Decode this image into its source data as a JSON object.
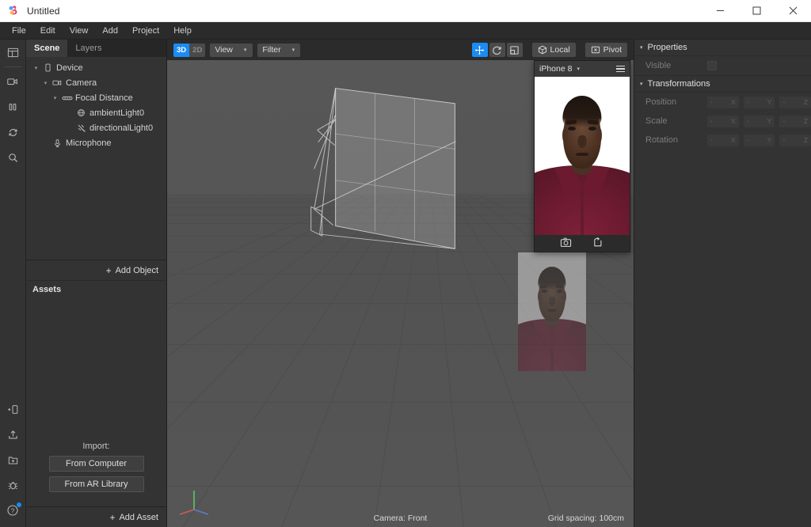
{
  "window": {
    "title": "Untitled",
    "logo_icon": "spark-ar-logo-icon",
    "minimize_label": "–",
    "maximize_label": "☐",
    "close_label": "✕"
  },
  "menubar": {
    "items": [
      {
        "label": "File"
      },
      {
        "label": "Edit"
      },
      {
        "label": "View"
      },
      {
        "label": "Add"
      },
      {
        "label": "Project"
      },
      {
        "label": "Help"
      }
    ]
  },
  "rail": {
    "top_icons": [
      {
        "name": "layout-panels-icon"
      },
      {
        "name": "camera-video-icon"
      },
      {
        "name": "pause-icon"
      },
      {
        "name": "refresh-icon"
      },
      {
        "name": "search-icon"
      }
    ],
    "bottom_icons": [
      {
        "name": "send-to-device-icon"
      },
      {
        "name": "upload-export-icon"
      },
      {
        "name": "add-folder-icon"
      },
      {
        "name": "bug-debug-icon"
      },
      {
        "name": "help-icon",
        "badge": true
      }
    ]
  },
  "left_panel": {
    "tabs": [
      {
        "label": "Scene",
        "active": true
      },
      {
        "label": "Layers",
        "active": false
      }
    ],
    "tree": [
      {
        "label": "Device",
        "depth": 0,
        "twisty": "▾",
        "icon": "device-phone-icon"
      },
      {
        "label": "Camera",
        "depth": 1,
        "twisty": "▾",
        "icon": "camera-icon"
      },
      {
        "label": "Focal Distance",
        "depth": 2,
        "twisty": "▾",
        "icon": "focal-distance-icon"
      },
      {
        "label": "ambientLight0",
        "depth": 3,
        "twisty": "",
        "icon": "ambient-light-icon"
      },
      {
        "label": "directionalLight0",
        "depth": 3,
        "twisty": "",
        "icon": "directional-light-icon"
      },
      {
        "label": "Microphone",
        "depth": 1,
        "twisty": "",
        "icon": "microphone-icon"
      }
    ],
    "add_object_label": "Add Object",
    "add_object_plus": "+",
    "assets_title": "Assets",
    "import_label": "Import:",
    "import_buttons": [
      {
        "label": "From Computer"
      },
      {
        "label": "From AR Library"
      }
    ],
    "add_asset_label": "Add Asset",
    "add_asset_plus": "+"
  },
  "toolbar": {
    "mode_3d": "3D",
    "mode_2d": "2D",
    "mode_active": "3D",
    "view_label": "View",
    "filter_label": "Filter",
    "caret": "▾",
    "tools": [
      {
        "name": "move-tool",
        "active": true
      },
      {
        "name": "rotate-tool",
        "active": false
      },
      {
        "name": "scale-tool",
        "active": false
      }
    ],
    "local_label": "Local",
    "pivot_label": "Pivot",
    "accent_color": "#1b8cf3"
  },
  "viewport": {
    "status_center": "Camera: Front",
    "status_right": "Grid spacing: 100cm",
    "axis_gizmo": {
      "y_color": "#5ec46a",
      "x_color": "#c45e5e",
      "z_color": "#5e7cc4"
    },
    "grid_color": "#4a4a4a",
    "background_top": "#565656",
    "background_bottom": "#525252"
  },
  "preview": {
    "device_label": "iPhone 8",
    "device_caret": "▾",
    "menu_icon": "hamburger-menu-icon",
    "footer_icons": [
      {
        "name": "screenshot-camera-icon"
      },
      {
        "name": "record-video-icon"
      }
    ]
  },
  "properties": {
    "sections": [
      {
        "title": "Properties",
        "caret": "▾"
      },
      {
        "title": "Transformations",
        "caret": "▾"
      }
    ],
    "visible_label": "Visible",
    "rows": [
      {
        "label": "Position",
        "fields": [
          {
            "value": "-",
            "axis": "X"
          },
          {
            "value": "-",
            "axis": "Y"
          },
          {
            "value": "-",
            "axis": "Z"
          }
        ]
      },
      {
        "label": "Scale",
        "fields": [
          {
            "value": "-",
            "axis": "X"
          },
          {
            "value": "-",
            "axis": "Y"
          },
          {
            "value": "-",
            "axis": "Z"
          }
        ]
      },
      {
        "label": "Rotation",
        "fields": [
          {
            "value": "-",
            "axis": "X"
          },
          {
            "value": "-",
            "axis": "Y"
          },
          {
            "value": "-",
            "axis": "Z"
          }
        ]
      }
    ]
  }
}
